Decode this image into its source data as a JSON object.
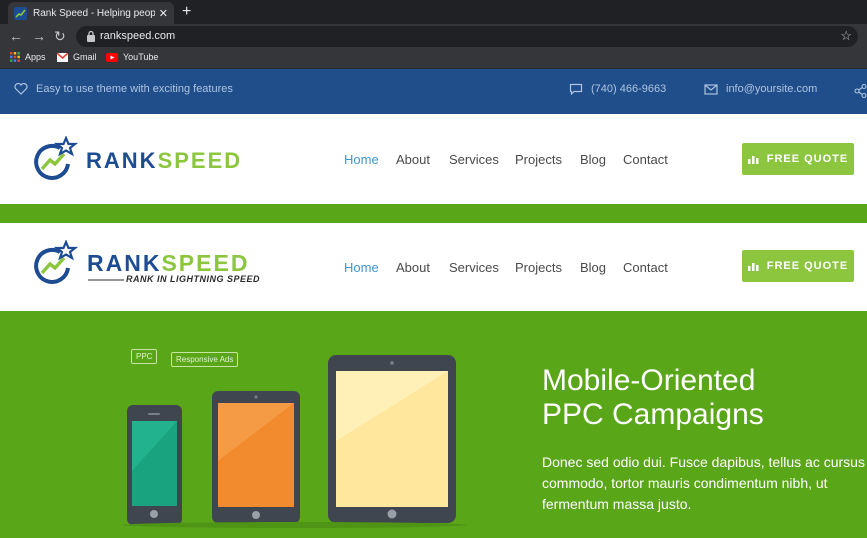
{
  "browser": {
    "tab_title": "Rank Speed - Helping people ran",
    "new_tab_label": "+",
    "close_label": "✕",
    "url": "rankspeed.com",
    "bookmarks": [
      {
        "label": "Apps",
        "icon": "apps-grid-icon"
      },
      {
        "label": "Gmail",
        "icon": "gmail-icon"
      },
      {
        "label": "YouTube",
        "icon": "youtube-icon"
      }
    ]
  },
  "topbar": {
    "tagline": "Easy to use theme with exciting features",
    "phone": "(740) 466-9663",
    "email": "info@yoursite.com"
  },
  "logo": {
    "rank": "RANK",
    "speed": "SPEED",
    "tagline": "RANK IN LIGHTNING SPEED"
  },
  "nav": {
    "items": [
      "Home",
      "About",
      "Services",
      "Projects",
      "Blog",
      "Contact"
    ],
    "active": "Home"
  },
  "quote_button": "FREE QUOTE",
  "hero": {
    "chips": [
      "PPC",
      "Responsive Ads"
    ],
    "title_line1": "Mobile-Oriented",
    "title_line2": "PPC Campaigns",
    "text": "Donec sed odio dui. Fusce dapibus, tellus ac cursus commodo, tortor mauris condimentum nibh, ut fermentum massa justo."
  },
  "colors": {
    "topbar": "#1f4e8a",
    "brand_green": "#8cc63f",
    "hero_green": "#5aa619",
    "nav_active": "#3a9ad9",
    "logo_blue": "#1d4c92"
  }
}
